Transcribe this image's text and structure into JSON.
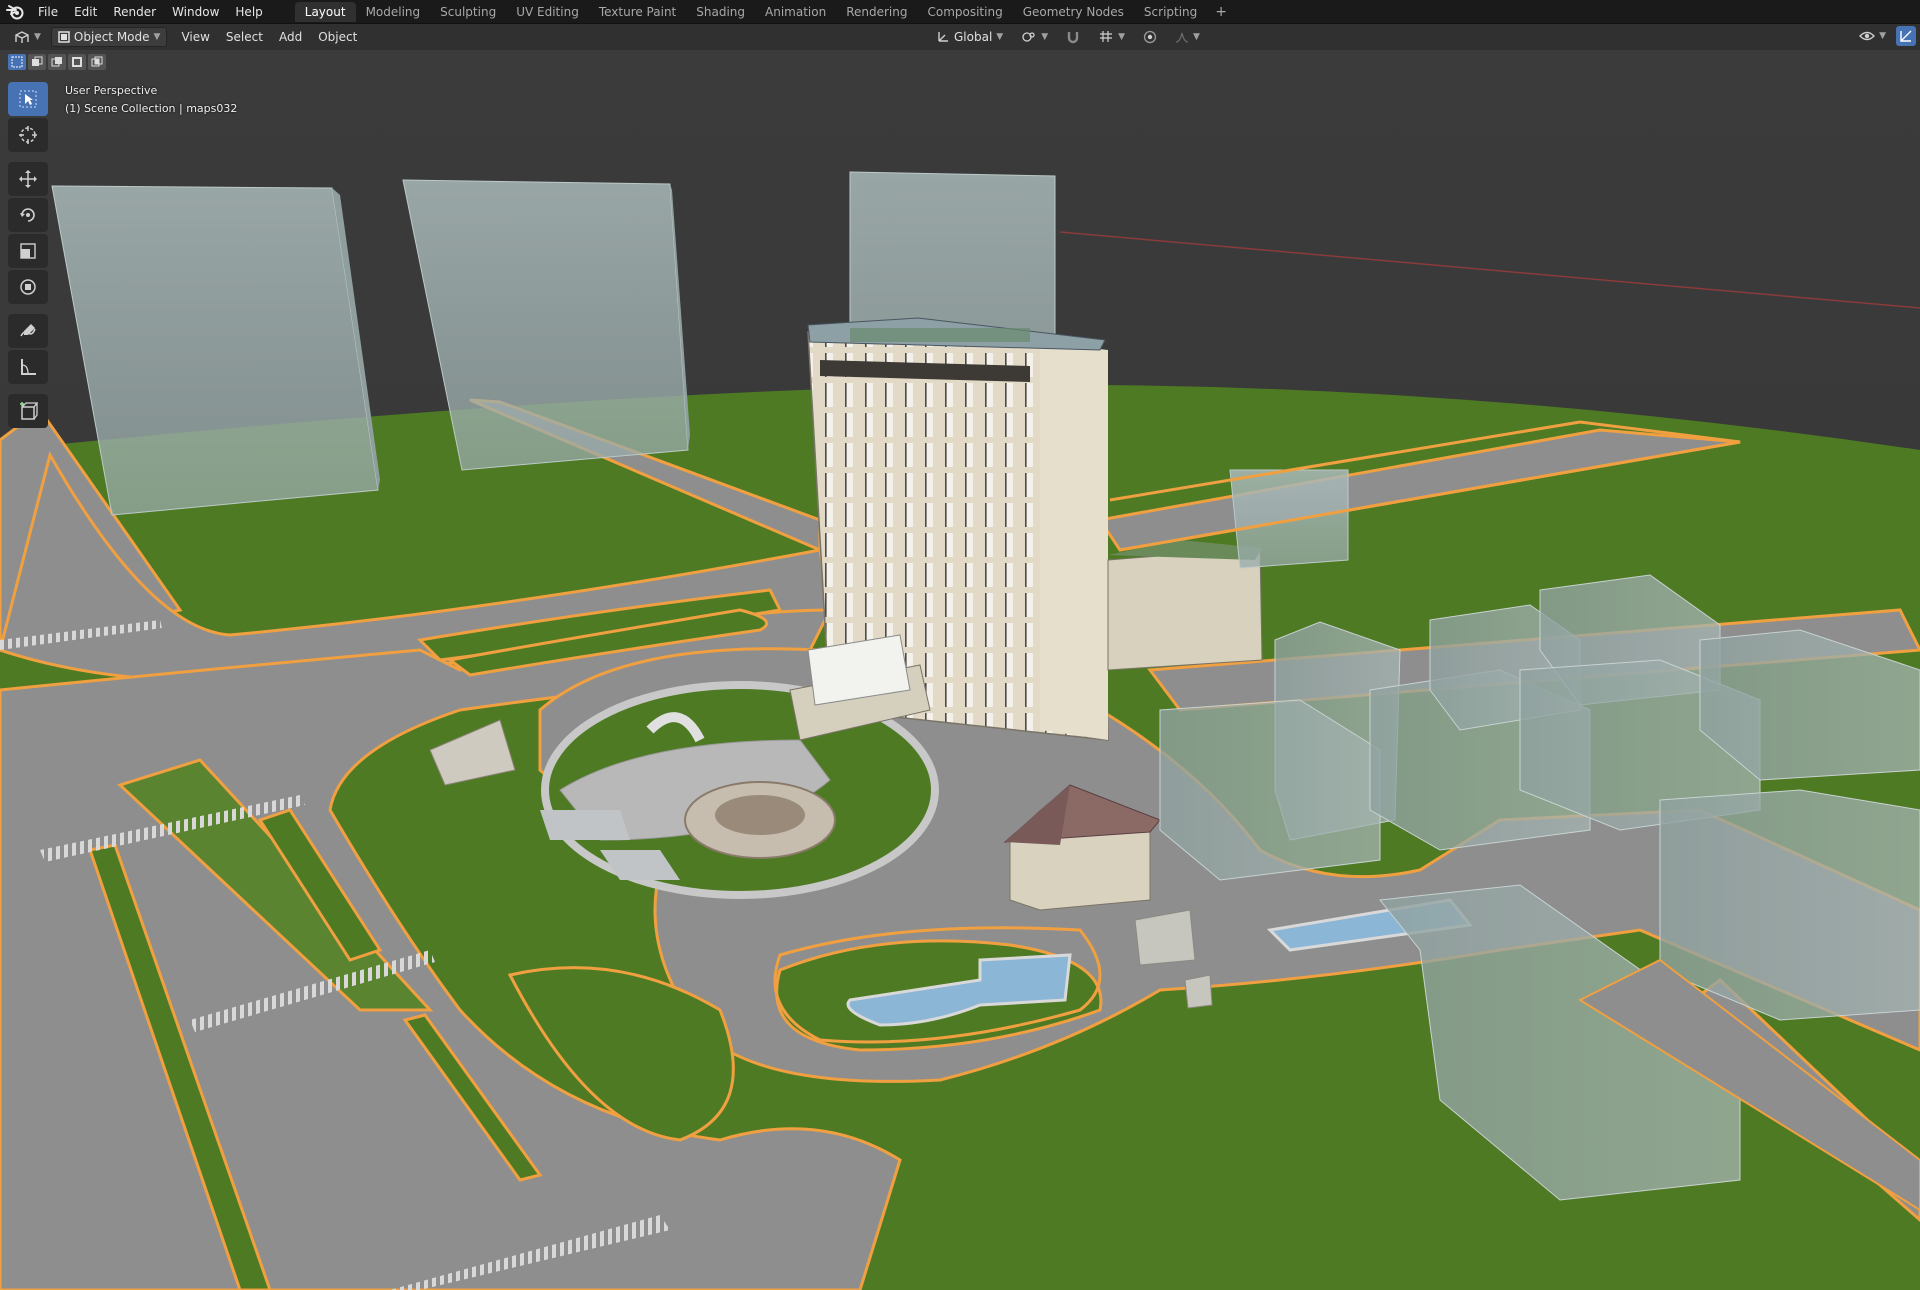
{
  "app": {
    "menu": [
      "File",
      "Edit",
      "Render",
      "Window",
      "Help"
    ],
    "workspaces": [
      {
        "label": "Layout",
        "active": true
      },
      {
        "label": "Modeling",
        "active": false
      },
      {
        "label": "Sculpting",
        "active": false
      },
      {
        "label": "UV Editing",
        "active": false
      },
      {
        "label": "Texture Paint",
        "active": false
      },
      {
        "label": "Shading",
        "active": false
      },
      {
        "label": "Animation",
        "active": false
      },
      {
        "label": "Rendering",
        "active": false
      },
      {
        "label": "Compositing",
        "active": false
      },
      {
        "label": "Geometry Nodes",
        "active": false
      },
      {
        "label": "Scripting",
        "active": false
      }
    ],
    "add_workspace": "+"
  },
  "header": {
    "mode": "Object Mode",
    "menus": [
      "View",
      "Select",
      "Add",
      "Object"
    ],
    "transform_orientation": "Global"
  },
  "viewport": {
    "perspective_label": "User Perspective",
    "collection_label": "(1) Scene Collection | maps032"
  },
  "toolbar": {
    "tools": [
      {
        "name": "select-box-tool",
        "icon": "cursor-arrow-icon",
        "active": true
      },
      {
        "name": "cursor-tool",
        "icon": "3d-cursor-icon",
        "active": false
      },
      {
        "name": "move-tool",
        "icon": "move-arrows-icon",
        "active": false
      },
      {
        "name": "rotate-tool",
        "icon": "rotate-icon",
        "active": false
      },
      {
        "name": "scale-tool",
        "icon": "scale-icon",
        "active": false
      },
      {
        "name": "transform-tool",
        "icon": "transform-icon",
        "active": false
      },
      {
        "name": "annotate-tool",
        "icon": "pencil-icon",
        "active": false
      },
      {
        "name": "measure-tool",
        "icon": "ruler-icon",
        "active": false
      },
      {
        "name": "add-cube-tool",
        "icon": "add-cube-icon",
        "active": false
      }
    ]
  },
  "colors": {
    "grass": "#4f7a24",
    "road": "#8b8b8b",
    "selection_outline": "#f0a040",
    "glass_block": "#a9b8b8",
    "tower": "#ddd5c0",
    "background": "#3a3a3a",
    "active_blue": "#4772b3"
  }
}
